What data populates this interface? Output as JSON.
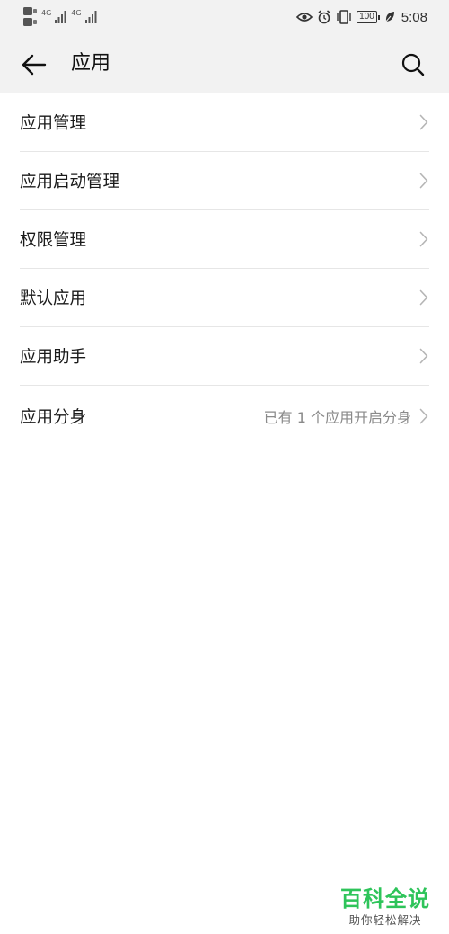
{
  "status_bar": {
    "network_left": "HD",
    "signal_1_label": "4G",
    "signal_2_label": "4G",
    "battery_level": "100",
    "time": "5:08"
  },
  "header": {
    "title": "应用",
    "back_icon": "arrow-left-icon",
    "search_icon": "search-icon"
  },
  "list": {
    "items": [
      {
        "label": "应用管理",
        "value": ""
      },
      {
        "label": "应用启动管理",
        "value": ""
      },
      {
        "label": "权限管理",
        "value": ""
      },
      {
        "label": "默认应用",
        "value": ""
      },
      {
        "label": "应用助手",
        "value": ""
      },
      {
        "label": "应用分身",
        "value": "已有 1 个应用开启分身"
      }
    ]
  },
  "watermark": {
    "title": "百科全说",
    "subtitle": "助你轻松解决"
  },
  "colors": {
    "header_bg": "#f2f2f2",
    "divider": "#e6e6e6",
    "watermark_green": "#2ec45a",
    "secondary_text": "#8a8a8a"
  }
}
